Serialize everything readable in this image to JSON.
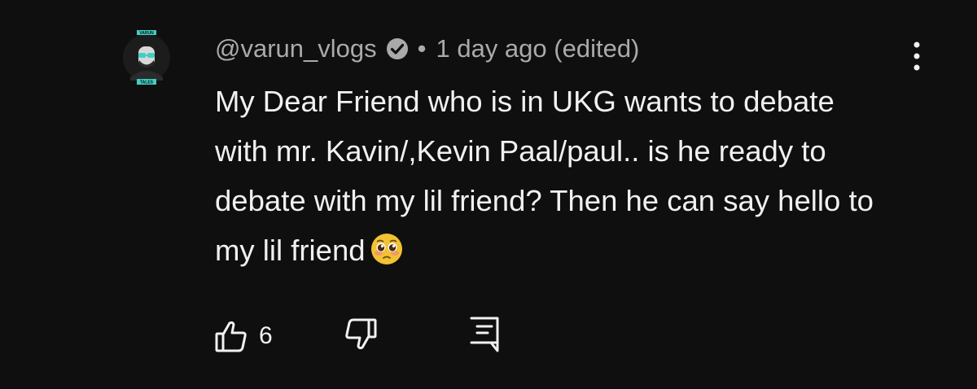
{
  "comment": {
    "author": "@varun_vlogs",
    "separator": "•",
    "timestamp": "1 day ago (edited)",
    "text": "My Dear Friend who is in UKG wants to debate with mr. Kavin/,Kevin Paal/paul.. is he ready to debate with my lil friend? Then he can say hello to my lil friend",
    "emoji": "pleading-face",
    "like_count": "6",
    "avatar_badge_top": "VARUN",
    "avatar_badge_bottom": "TALES"
  },
  "icons": {
    "verified": "verified-check-icon",
    "more": "more-vertical-icon",
    "like": "thumbs-up-icon",
    "dislike": "thumbs-down-icon",
    "reply": "reply-comment-icon"
  },
  "colors": {
    "background": "#0f0f0f",
    "text_primary": "#f1f1f1",
    "text_secondary": "#aaaaaa",
    "avatar_accent": "#3fd0c4"
  }
}
